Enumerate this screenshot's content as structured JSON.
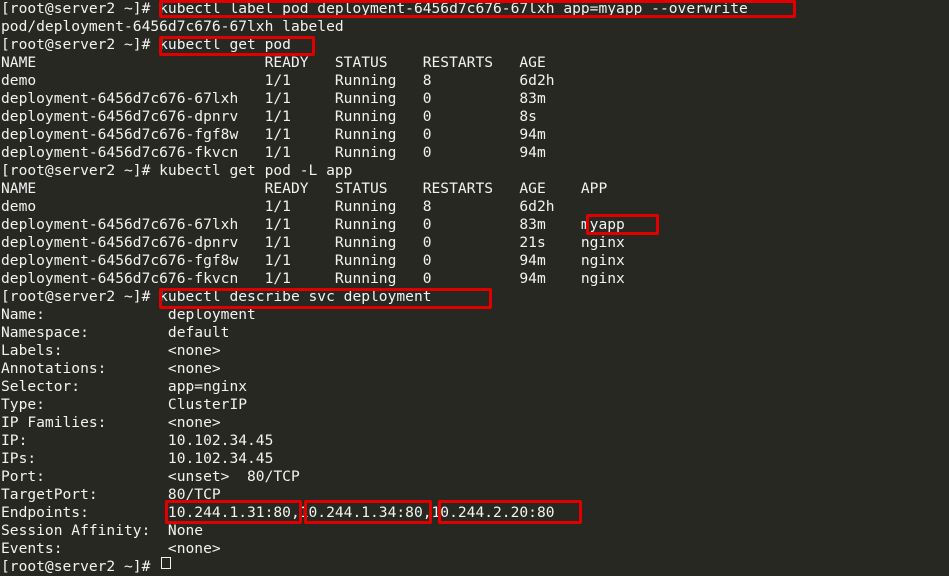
{
  "terminal": {
    "lines": [
      "[root@server2 ~]# kubectl label pod deployment-6456d7c676-67lxh app=myapp --overwrite",
      "pod/deployment-6456d7c676-67lxh labeled",
      "[root@server2 ~]# kubectl get pod",
      "NAME                          READY   STATUS    RESTARTS   AGE",
      "demo                          1/1     Running   8          6d2h",
      "deployment-6456d7c676-67lxh   1/1     Running   0          83m",
      "deployment-6456d7c676-dpnrv   1/1     Running   0          8s",
      "deployment-6456d7c676-fgf8w   1/1     Running   0          94m",
      "deployment-6456d7c676-fkvcn   1/1     Running   0          94m",
      "[root@server2 ~]# kubectl get pod -L app",
      "NAME                          READY   STATUS    RESTARTS   AGE    APP",
      "demo                          1/1     Running   8          6d2h",
      "deployment-6456d7c676-67lxh   1/1     Running   0          83m    myapp",
      "deployment-6456d7c676-dpnrv   1/1     Running   0          21s    nginx",
      "deployment-6456d7c676-fgf8w   1/1     Running   0          94m    nginx",
      "deployment-6456d7c676-fkvcn   1/1     Running   0          94m    nginx",
      "[root@server2 ~]# kubectl describe svc deployment",
      "Name:              deployment",
      "Namespace:         default",
      "Labels:            <none>",
      "Annotations:       <none>",
      "Selector:          app=nginx",
      "Type:              ClusterIP",
      "IP Families:       <none>",
      "IP:                10.102.34.45",
      "IPs:               10.102.34.45",
      "Port:              <unset>  80/TCP",
      "TargetPort:        80/TCP",
      "Endpoints:         10.244.1.31:80,10.244.1.34:80,10.244.2.20:80",
      "Session Affinity:  None",
      "Events:            <none>",
      "[root@server2 ~]# "
    ]
  }
}
